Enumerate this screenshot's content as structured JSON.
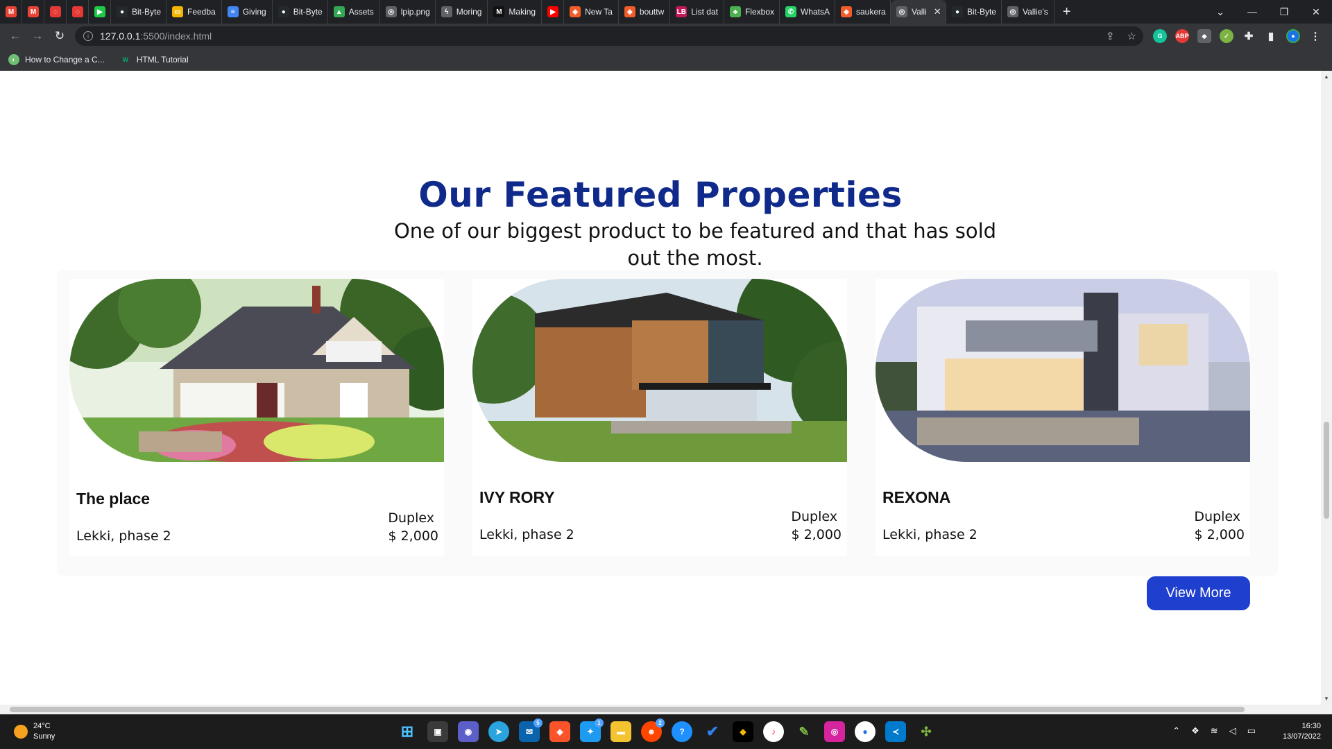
{
  "browser": {
    "tabs": [
      {
        "label": "",
        "icon": "gmail-icon",
        "color": "#ea4335",
        "glyph": "M"
      },
      {
        "label": "",
        "icon": "gmail-icon",
        "color": "#ea4335",
        "glyph": "M"
      },
      {
        "label": "",
        "icon": "ring-icon",
        "color": "#e53935",
        "glyph": "◌"
      },
      {
        "label": "",
        "icon": "ring-icon",
        "color": "#e53935",
        "glyph": "◌"
      },
      {
        "label": "",
        "icon": "app-icon",
        "color": "#1ec948",
        "glyph": "▶"
      },
      {
        "label": "Bit-Byte",
        "icon": "github-icon",
        "color": "#24292e",
        "glyph": "●"
      },
      {
        "label": "Feedba",
        "icon": "slides-icon",
        "color": "#f4b400",
        "glyph": "▭"
      },
      {
        "label": "Giving",
        "icon": "docs-icon",
        "color": "#4285f4",
        "glyph": "≡"
      },
      {
        "label": "Bit-Byte",
        "icon": "github-icon",
        "color": "#24292e",
        "glyph": "●"
      },
      {
        "label": "Assets",
        "icon": "drive-icon",
        "color": "#34a853",
        "glyph": "▲"
      },
      {
        "label": "lpip.png",
        "icon": "globe-icon",
        "color": "#5f6368",
        "glyph": "◎"
      },
      {
        "label": "Moring",
        "icon": "bolt-icon",
        "color": "#5f6368",
        "glyph": "ϟ"
      },
      {
        "label": "Making",
        "icon": "medium-icon",
        "color": "#111111",
        "glyph": "M"
      },
      {
        "label": "",
        "icon": "youtube-icon",
        "color": "#ff0000",
        "glyph": "▶"
      },
      {
        "label": "New Ta",
        "icon": "brave-icon",
        "color": "#f25c2a",
        "glyph": "◈"
      },
      {
        "label": "bouttw",
        "icon": "brave-icon",
        "color": "#f25c2a",
        "glyph": "◈"
      },
      {
        "label": "List dat",
        "icon": "lb-icon",
        "color": "#c2185b",
        "glyph": "LB"
      },
      {
        "label": "Flexbox",
        "icon": "frog-icon",
        "color": "#4caf50",
        "glyph": "♣"
      },
      {
        "label": "WhatsA",
        "icon": "whatsapp-icon",
        "color": "#25d366",
        "glyph": "✆"
      },
      {
        "label": "saukera",
        "icon": "brave-icon",
        "color": "#f25c2a",
        "glyph": "◈"
      },
      {
        "label": "Valli",
        "icon": "globe-icon",
        "color": "#5f6368",
        "glyph": "◎",
        "active": true
      },
      {
        "label": "Bit-Byte",
        "icon": "github-icon",
        "color": "#24292e",
        "glyph": "●"
      },
      {
        "label": "Vallie's",
        "icon": "globe-icon",
        "color": "#5f6368",
        "glyph": "◎"
      }
    ],
    "url_host": "127.0.0.1",
    "url_path": ":5500/index.html",
    "bookmarks": [
      {
        "label": "How to Change a C...",
        "icon": "bookmark-site-icon",
        "color": "#6fbf73"
      },
      {
        "label": "HTML Tutorial",
        "icon": "w3schools-icon",
        "color": "#04aa6d"
      }
    ]
  },
  "section": {
    "title": "Our Featured Properties",
    "subtitle": "One of our biggest product to be featured and that has sold out the most."
  },
  "properties": [
    {
      "name": "The place",
      "type": "Duplex",
      "location": "Lekki, phase 2",
      "price": "$ 2,000"
    },
    {
      "name": "IVY RORY",
      "type": "Duplex",
      "location": "Lekki, phase 2",
      "price": "$ 2,000"
    },
    {
      "name": "REXONA",
      "type": "Duplex",
      "location": "Lekki, phase 2",
      "price": "$ 2,000"
    }
  ],
  "actions": {
    "view_more": "View More"
  },
  "taskbar": {
    "temperature": "24°C",
    "weather": "Sunny",
    "time": "16:30",
    "date": "13/07/2022",
    "badges": {
      "mail": "5",
      "twitter": "1",
      "reddit": "2"
    }
  },
  "colors": {
    "heading": "#0f2a8a",
    "button": "#1f3fcf"
  }
}
